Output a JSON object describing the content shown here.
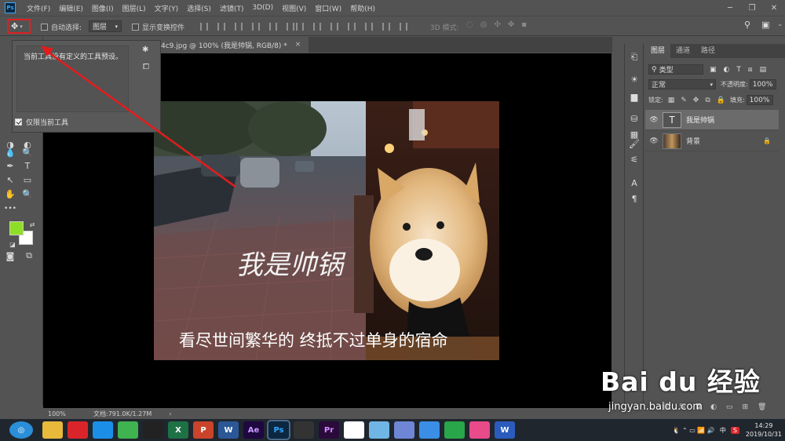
{
  "menu": {
    "logo": "Ps",
    "items": [
      "文件(F)",
      "编辑(E)",
      "图像(I)",
      "图层(L)",
      "文字(Y)",
      "选择(S)",
      "滤镜(T)",
      "3D(D)",
      "视图(V)",
      "窗口(W)",
      "帮助(H)"
    ]
  },
  "options": {
    "auto_select_label": "自动选择:",
    "auto_select_value": "图层",
    "show_transform_label": "显示变换控件",
    "mode_3d_label": "3D 模式:"
  },
  "tab": {
    "title": "4c9.jpg @ 100% (我是帅锅, RGB/8) *"
  },
  "preset_popup": {
    "empty_text": "当前工具没有定义的工具预设。",
    "current_only_label": "仅限当前工具"
  },
  "image": {
    "title_text": "我是帅锅",
    "caption": "看尽世间繁华的 终抵不过单身的宿命"
  },
  "layers_panel": {
    "tabs": [
      "图层",
      "通道",
      "路径"
    ],
    "filter_kind": "类型",
    "blend_mode": "正常",
    "opacity_label": "不透明度:",
    "opacity_value": "100%",
    "lock_label": "锁定:",
    "fill_label": "填充:",
    "fill_value": "100%",
    "layers": [
      {
        "name": "我是帅锅",
        "type": "text",
        "selected": true
      },
      {
        "name": "背景",
        "type": "image",
        "locked": true
      }
    ]
  },
  "status": {
    "zoom": "100%",
    "doc": "文档:791.0K/1.27M"
  },
  "taskbar": {
    "apps": [
      {
        "name": "folder",
        "color": "#e8b93a"
      },
      {
        "name": "netease-music",
        "color": "#d9252a"
      },
      {
        "name": "kugou",
        "color": "#1b8fe8"
      },
      {
        "name": "wechat",
        "color": "#3fb34f"
      },
      {
        "name": "qq",
        "color": "#222"
      },
      {
        "name": "excel",
        "color": "#1e7145",
        "label": "X"
      },
      {
        "name": "powerpoint",
        "color": "#c9442a",
        "label": "P"
      },
      {
        "name": "word",
        "color": "#2b5797",
        "label": "W"
      },
      {
        "name": "after-effects",
        "color": "#1f0740",
        "label": "Ae"
      },
      {
        "name": "photoshop",
        "color": "#0c2740",
        "label": "Ps"
      },
      {
        "name": "video",
        "color": "#333",
        "label": ""
      },
      {
        "name": "premiere",
        "color": "#2a0a3a",
        "label": "Pr"
      },
      {
        "name": "app-1",
        "color": "#fff",
        "label": ""
      },
      {
        "name": "app-2",
        "color": "#6fb6e6",
        "label": ""
      },
      {
        "name": "app-3",
        "color": "#6f86d6",
        "label": ""
      },
      {
        "name": "app-4",
        "color": "#3a8ee6",
        "label": ""
      },
      {
        "name": "app-5",
        "color": "#2aa64a",
        "label": ""
      },
      {
        "name": "app-6",
        "color": "#e84a8a",
        "label": ""
      },
      {
        "name": "wps",
        "color": "#2b5cbd",
        "label": "W"
      }
    ],
    "ime": "中",
    "time": "14:29",
    "date": "2019/10/31"
  },
  "watermark": {
    "brand": "Bai du 经验",
    "url": "jingyan.baidu.com"
  }
}
